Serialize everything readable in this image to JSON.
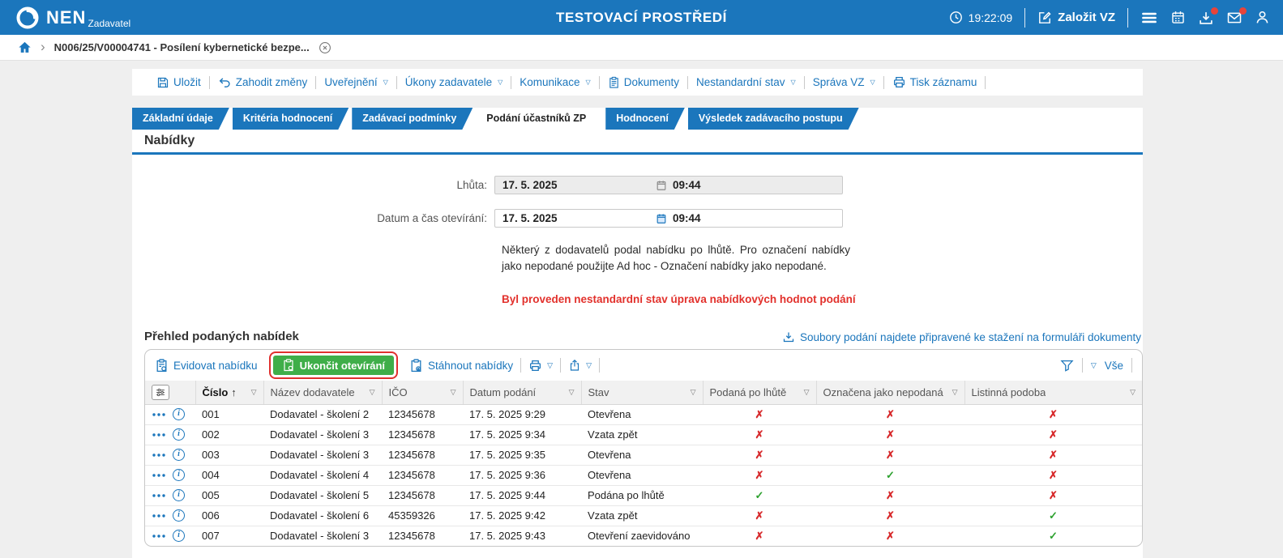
{
  "glyphs": {
    "check": "✓",
    "cross": "✗",
    "caret": "▽",
    "chevron": "›",
    "sort_up": "↑",
    "info": "i"
  },
  "colors": {
    "accent": "#1b76bc",
    "green_button": "#3fae49",
    "highlight_box": "#e0302e",
    "warning_text": "#e2312c",
    "mark_yes": "#2da12f",
    "mark_no": "#d7282a"
  },
  "header": {
    "brand_name": "NEN",
    "brand_subtitle": "Zadavatel",
    "env_title": "TESTOVACÍ PROSTŘEDÍ",
    "time": "19:22:09",
    "new_vz_label": "Založit VZ"
  },
  "breadcrumb": {
    "title": "N006/25/V00004741 - Posílení kybernetické bezpe..."
  },
  "toolbar": {
    "items": [
      {
        "id": "ulozit",
        "label": "Uložit",
        "icon": "save"
      },
      {
        "id": "zahodit-zmeny",
        "label": "Zahodit změny",
        "icon": "undo"
      },
      {
        "id": "uverejneni",
        "label": "Uveřejnění",
        "caret": true
      },
      {
        "id": "ukony-zadavatele",
        "label": "Úkony zadavatele",
        "caret": true
      },
      {
        "id": "komunikace",
        "label": "Komunikace",
        "caret": true
      },
      {
        "id": "dokumenty",
        "label": "Dokumenty",
        "icon": "doc"
      },
      {
        "id": "nestandardni-stav",
        "label": "Nestandardní stav",
        "caret": true
      },
      {
        "id": "sprava-vz",
        "label": "Správa VZ",
        "caret": true
      },
      {
        "id": "tisk-zaznamu",
        "label": "Tisk záznamu",
        "icon": "print"
      }
    ]
  },
  "tabs": {
    "active_index": 3,
    "items": [
      {
        "id": "zakladni-udaje",
        "label": "Základní údaje"
      },
      {
        "id": "kriteria-hodnoceni",
        "label": "Kritéria hodnocení"
      },
      {
        "id": "zadavaci-podminky",
        "label": "Zadávací podmínky"
      },
      {
        "id": "podani-ucastniku-zp",
        "label": "Podání účastníků ZP"
      },
      {
        "id": "hodnoceni",
        "label": "Hodnocení"
      },
      {
        "id": "vysledek-zadavaciho-postupu",
        "label": "Výsledek zadávacího postupu"
      }
    ]
  },
  "section": {
    "title": "Nabídky"
  },
  "form": {
    "deadline": {
      "label": "Lhůta:",
      "date": "17. 5. 2025",
      "time": "09:44"
    },
    "opening": {
      "label": "Datum a čas otevírání:",
      "date": "17. 5. 2025",
      "time": "09:44"
    },
    "notice": "Některý z dodavatelů podal nabídku po lhůtě. Pro označení nabídky jako nepodané použijte Ad hoc - Označení nabídky jako nepodané.",
    "warning": "Byl proveden nestandardní stav úprava nabídkových hodnot podání"
  },
  "list": {
    "title": "Přehled podaných nabídek",
    "download_link": "Soubory podání najdete připravené ke stažení na formuláři dokumenty",
    "toolbar": {
      "evidovat": "Evidovat nabídku",
      "ukoncit": "Ukončit otevírání",
      "stahnout": "Stáhnout nabídky",
      "vse": "Vše"
    },
    "columns": [
      {
        "id": "cislo",
        "label": "Číslo",
        "sorted": true
      },
      {
        "id": "nazev-dodavatele",
        "label": "Název dodavatele"
      },
      {
        "id": "ico",
        "label": "IČO"
      },
      {
        "id": "datum-podani",
        "label": "Datum podání"
      },
      {
        "id": "stav",
        "label": "Stav"
      },
      {
        "id": "podana-po-lhute",
        "label": "Podaná po lhůtě"
      },
      {
        "id": "oznacena-jako-nepodana",
        "label": "Označena jako nepodaná"
      },
      {
        "id": "listinna-podoba",
        "label": "Listinná podoba"
      }
    ],
    "rows": [
      {
        "cislo": "001",
        "nazev": "Dodavatel - školení 2",
        "ico": "12345678",
        "datum": "17. 5. 2025 9:29",
        "stav": "Otevřena",
        "po_lhute": false,
        "nepodana": false,
        "listinna": false
      },
      {
        "cislo": "002",
        "nazev": "Dodavatel - školení 3",
        "ico": "12345678",
        "datum": "17. 5. 2025 9:34",
        "stav": "Vzata zpět",
        "po_lhute": false,
        "nepodana": false,
        "listinna": false
      },
      {
        "cislo": "003",
        "nazev": "Dodavatel - školení 3",
        "ico": "12345678",
        "datum": "17. 5. 2025 9:35",
        "stav": "Otevřena",
        "po_lhute": false,
        "nepodana": false,
        "listinna": false
      },
      {
        "cislo": "004",
        "nazev": "Dodavatel - školení 4",
        "ico": "12345678",
        "datum": "17. 5. 2025 9:36",
        "stav": "Otevřena",
        "po_lhute": false,
        "nepodana": true,
        "listinna": false
      },
      {
        "cislo": "005",
        "nazev": "Dodavatel - školení 5",
        "ico": "12345678",
        "datum": "17. 5. 2025 9:44",
        "stav": "Podána po lhůtě",
        "po_lhute": true,
        "nepodana": false,
        "listinna": false
      },
      {
        "cislo": "006",
        "nazev": "Dodavatel - školení 6",
        "ico": "45359326",
        "datum": "17. 5. 2025 9:42",
        "stav": "Vzata zpět",
        "po_lhute": false,
        "nepodana": false,
        "listinna": true
      },
      {
        "cislo": "007",
        "nazev": "Dodavatel - školení 3",
        "ico": "12345678",
        "datum": "17. 5. 2025 9:43",
        "stav": "Otevření zaevidováno",
        "po_lhute": false,
        "nepodana": false,
        "listinna": true
      }
    ]
  }
}
